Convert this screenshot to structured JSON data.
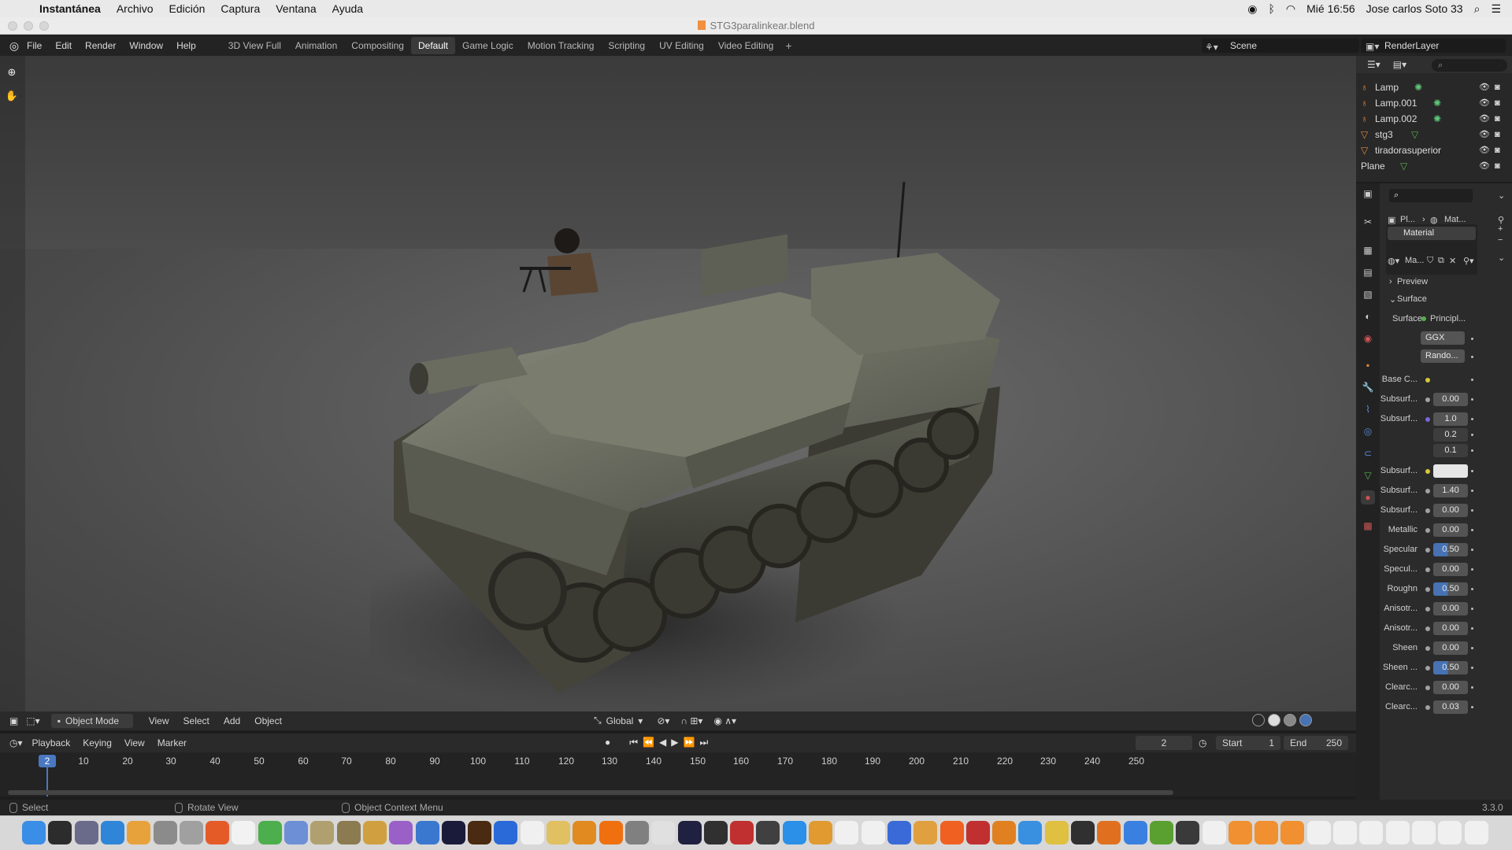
{
  "mac_menu": {
    "app": "Instantánea",
    "items": [
      "Archivo",
      "Edición",
      "Captura",
      "Ventana",
      "Ayuda"
    ],
    "clock": "Mié 16:56",
    "user": "Jose carlos Soto 33"
  },
  "window": {
    "title": "STG3paralinkear.blend"
  },
  "topbar": {
    "menus": [
      "File",
      "Edit",
      "Render",
      "Window",
      "Help"
    ],
    "workspaces": [
      "3D View Full",
      "Animation",
      "Compositing",
      "Default",
      "Game Logic",
      "Motion Tracking",
      "Scripting",
      "UV Editing",
      "Video Editing"
    ],
    "active_workspace": "Default",
    "add_workspace": "+",
    "scene": "Scene",
    "render_layer": "RenderLayer"
  },
  "viewport_header": {
    "mode": "Object Mode",
    "menus": [
      "View",
      "Select",
      "Add",
      "Object"
    ],
    "orientation": "Global"
  },
  "timeline": {
    "menus": [
      "Playback",
      "Keying",
      "View",
      "Marker"
    ],
    "current_frame": "2",
    "start_label": "Start",
    "start": "1",
    "end_label": "End",
    "end": "250",
    "ticks": [
      "10",
      "20",
      "30",
      "40",
      "50",
      "60",
      "70",
      "80",
      "90",
      "100",
      "110",
      "120",
      "130",
      "140",
      "150",
      "160",
      "170",
      "180",
      "190",
      "200",
      "210",
      "220",
      "230",
      "240",
      "250"
    ]
  },
  "status": {
    "select": "Select",
    "rotate": "Rotate View",
    "context": "Object Context Menu",
    "version": "3.3.0"
  },
  "outliner": {
    "rows": [
      {
        "name": "Lamp",
        "type": "light"
      },
      {
        "name": "Lamp.001",
        "type": "light"
      },
      {
        "name": "Lamp.002",
        "type": "light"
      },
      {
        "name": "stg3",
        "type": "mesh"
      },
      {
        "name": "tiradorasuperior",
        "type": "mesh"
      },
      {
        "name": "Plane",
        "type": "mesh"
      }
    ]
  },
  "properties": {
    "breadcrumb_object": "Pl...",
    "breadcrumb_material": "Mat...",
    "material_slot": "Material",
    "material_name": "Ma...",
    "preview_label": "Preview",
    "surface_section": "Surface",
    "surface_label": "Surface",
    "surface_value": "Principl...",
    "distribution": "GGX",
    "subsurface_method": "Rando...",
    "fields": [
      {
        "label": "Base C...",
        "value": "",
        "dot": "y"
      },
      {
        "label": "Subsurf...",
        "value": "0.00",
        "dot": ""
      },
      {
        "label": "Subsurf...",
        "value": "1.0",
        "dot": "p"
      },
      {
        "label": "",
        "value": "0.2",
        "dot": ""
      },
      {
        "label": "",
        "value": "0.1",
        "dot": ""
      },
      {
        "label": "Subsurf...",
        "value": "",
        "dot": "y"
      },
      {
        "label": "Subsurf...",
        "value": "1.40",
        "dot": ""
      },
      {
        "label": "Subsurf...",
        "value": "0.00",
        "dot": ""
      },
      {
        "label": "Metallic",
        "value": "0.00",
        "dot": ""
      },
      {
        "label": "Specular",
        "value": "0.50",
        "dot": ""
      },
      {
        "label": "Specul...",
        "value": "0.00",
        "dot": ""
      },
      {
        "label": "Roughn",
        "value": "0.50",
        "dot": ""
      },
      {
        "label": "Anisotr...",
        "value": "0.00",
        "dot": ""
      },
      {
        "label": "Anisotr...",
        "value": "0.00",
        "dot": ""
      },
      {
        "label": "Sheen",
        "value": "0.00",
        "dot": ""
      },
      {
        "label": "Sheen ...",
        "value": "0.50",
        "dot": ""
      },
      {
        "label": "Clearc...",
        "value": "0.00",
        "dot": ""
      },
      {
        "label": "Clearc...",
        "value": "0.03",
        "dot": ""
      }
    ]
  },
  "colors": {
    "accent": "#4772b3",
    "active_frame": "#4a78c0",
    "object_icon": "#e08a3c",
    "light_data": "#5fc77a",
    "mesh_data": "#55b050"
  }
}
